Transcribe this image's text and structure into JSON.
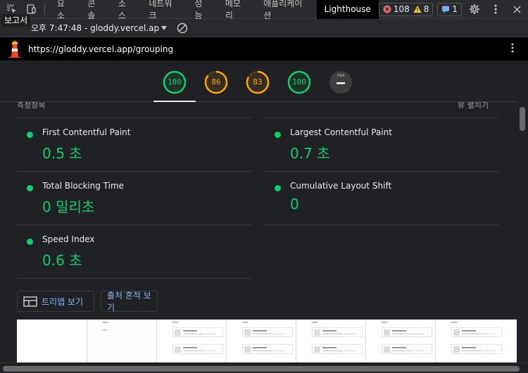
{
  "devtools": {
    "tabs": [
      "요소",
      "콘솔",
      "소스",
      "네트워크",
      "성능",
      "메모리",
      "애플리케이션",
      "Lighthouse"
    ],
    "active_tab": "Lighthouse",
    "errors": "108",
    "warnings": "8",
    "messages": "1"
  },
  "report": {
    "tooltip": "보고서",
    "selected": "오후 7:47:48 - gloddy.vercel.ap"
  },
  "url": "https://gloddy.vercel.app/grouping",
  "scores": [
    {
      "value": "100",
      "color": "#0cce6b",
      "fraction": 1.0
    },
    {
      "value": "86",
      "color": "#ffa400",
      "fraction": 0.86
    },
    {
      "value": "83",
      "color": "#ffa400",
      "fraction": 0.83
    },
    {
      "value": "100",
      "color": "#0cce6b",
      "fraction": 1.0
    },
    {
      "value": "PWA",
      "color": "#9aa0a6",
      "fraction": 0
    }
  ],
  "partial_header": {
    "left": "측정항목",
    "right": "뷰 펼치기"
  },
  "metrics": [
    {
      "label": "First Contentful Paint",
      "value": "0.5 초"
    },
    {
      "label": "Largest Contentful Paint",
      "value": "0.7 초"
    },
    {
      "label": "Total Blocking Time",
      "value": "0 밀리초"
    },
    {
      "label": "Cumulative Layout Shift",
      "value": "0"
    },
    {
      "label": "Speed Index",
      "value": "0.6 초"
    }
  ],
  "buttons": {
    "treemap": "트리맵 보기",
    "trace": "출처 흔적 보기"
  },
  "colors": {
    "pass": "#0cce6b",
    "average": "#ffa400",
    "link": "#8ab4f8"
  }
}
